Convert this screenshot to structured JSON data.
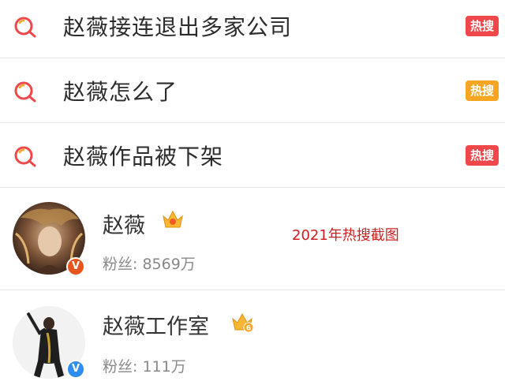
{
  "hot_searches": [
    {
      "query": "赵薇接连退出多家公司",
      "badge": "热搜",
      "badge_color": "#f0484a"
    },
    {
      "query": "赵薇怎么了",
      "badge": "热搜",
      "badge_color": "#f6a623"
    },
    {
      "query": "赵薇作品被下架",
      "badge": "热搜",
      "badge_color": "#f0484a"
    }
  ],
  "users": [
    {
      "name": "赵薇",
      "fans_label": "粉丝:",
      "fans_value": "8569万",
      "verified_color": "#e8541e",
      "crown_icon": "vip-crown-icon"
    },
    {
      "name": "赵薇工作室",
      "fans_label": "粉丝:",
      "fans_value": "111万",
      "verified_color": "#2d8ef0",
      "crown_icon": "vip-crown-6-icon",
      "crown_level": "6"
    }
  ],
  "annotation": "2021年热搜截图",
  "colors": {
    "search_icon": "#f0484a",
    "search_icon_accent": "#f6a623"
  }
}
